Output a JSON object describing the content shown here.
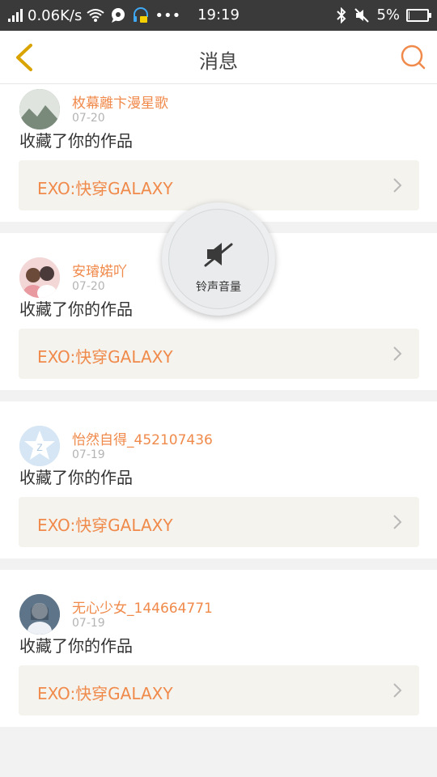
{
  "status_bar": {
    "network_speed": "0.06K/s",
    "time": "19:19",
    "battery": "5%",
    "battery_level": 0.05
  },
  "header": {
    "title": "消息",
    "back_icon": "chevron-left-icon",
    "search_icon": "search-icon"
  },
  "overlay": {
    "label": "铃声音量",
    "icon": "speaker-muted-icon"
  },
  "notifications": [
    {
      "user": "枚幕離卞漫星歌",
      "date": "07-20",
      "action": "收藏了你的作品",
      "work_title": "EXO:快穿GALAXY",
      "avatar_color": "#7a8a7a"
    },
    {
      "user": "安璿婼吖",
      "date": "07-20",
      "action": "收藏了你的作品",
      "work_title": "EXO:快穿GALAXY",
      "avatar_color": "#e8a5a5"
    },
    {
      "user": "怡然自得_452107436",
      "date": "07-19",
      "action": "收藏了你的作品",
      "work_title": "EXO:快穿GALAXY",
      "avatar_color": "#cfe1f1"
    },
    {
      "user": "无心少女_144664771",
      "date": "07-19",
      "action": "收藏了你的作品",
      "work_title": "EXO:快穿GALAXY",
      "avatar_color": "#8fa5b8"
    }
  ],
  "colors": {
    "accent": "#f08a4b",
    "back_icon": "#d9a300"
  }
}
